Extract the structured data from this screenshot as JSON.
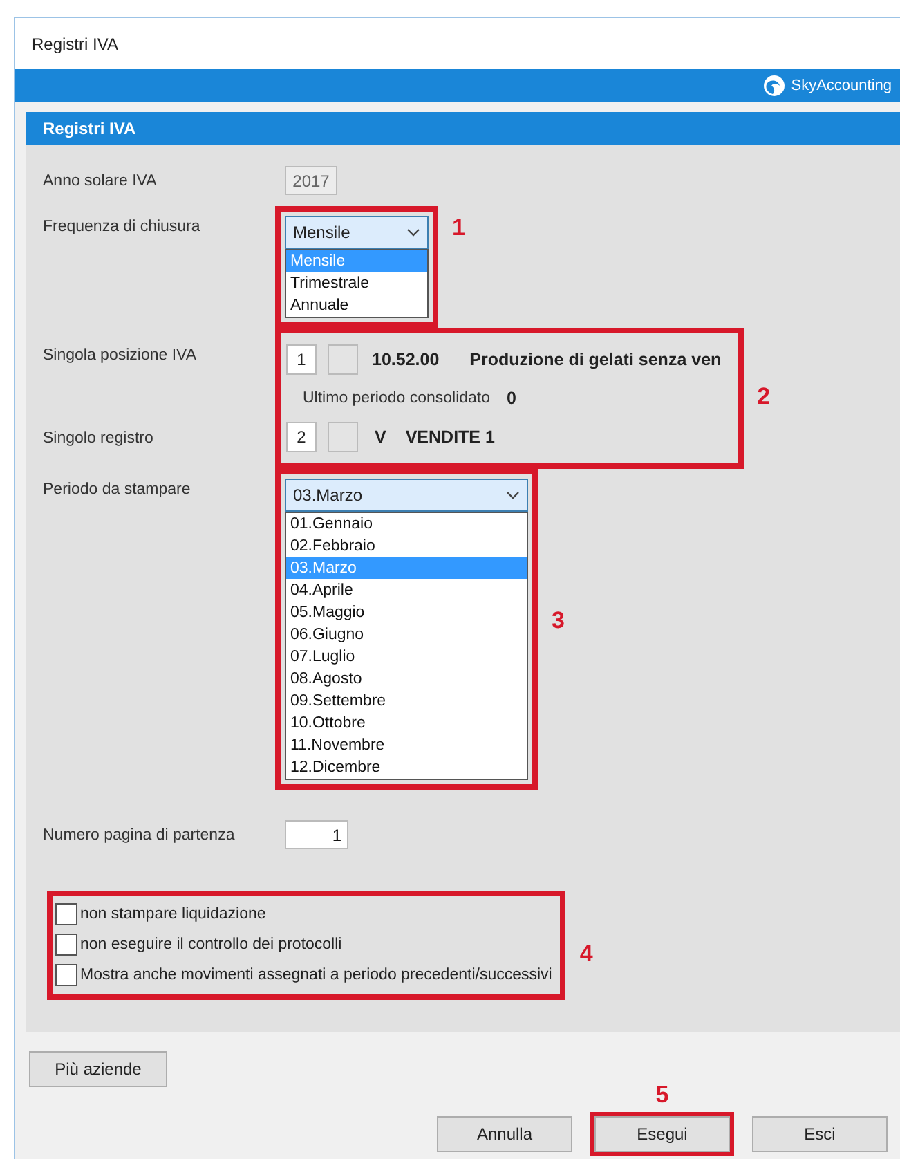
{
  "window": {
    "title": "Registri IVA"
  },
  "brand": {
    "name": "SkyAccounting"
  },
  "panel": {
    "title": "Registri IVA"
  },
  "anno": {
    "label": "Anno solare IVA",
    "value": "2017",
    "disabled": true
  },
  "frequenza": {
    "label": "Frequenza di chiusura",
    "value": "Mensile",
    "annotation": "1",
    "options": [
      {
        "label": "Mensile",
        "selected": true
      },
      {
        "label": "Trimestrale",
        "selected": false
      },
      {
        "label": "Annuale",
        "selected": false
      }
    ]
  },
  "selezione": {
    "annotation": "2",
    "posizione": {
      "label": "Singola posizione IVA",
      "value": "1",
      "code": "10.52.00",
      "description": "Produzione di gelati senza ven"
    },
    "ultimo": {
      "label": "Ultimo periodo consolidato",
      "value": "0"
    },
    "registro": {
      "label": "Singolo registro",
      "value": "2",
      "type": "V",
      "name": "VENDITE 1"
    }
  },
  "periodo": {
    "label": "Periodo da stampare",
    "value": "03.Marzo",
    "annotation": "3",
    "options": [
      {
        "label": "01.Gennaio",
        "selected": false
      },
      {
        "label": "02.Febbraio",
        "selected": false
      },
      {
        "label": "03.Marzo",
        "selected": true
      },
      {
        "label": "04.Aprile",
        "selected": false
      },
      {
        "label": "05.Maggio",
        "selected": false
      },
      {
        "label": "06.Giugno",
        "selected": false
      },
      {
        "label": "07.Luglio",
        "selected": false
      },
      {
        "label": "08.Agosto",
        "selected": false
      },
      {
        "label": "09.Settembre",
        "selected": false
      },
      {
        "label": "10.Ottobre",
        "selected": false
      },
      {
        "label": "11.Novembre",
        "selected": false
      },
      {
        "label": "12.Dicembre",
        "selected": false
      }
    ]
  },
  "numero_pagina": {
    "label": "Numero pagina di partenza",
    "value": "1"
  },
  "opzioni": {
    "annotation": "4",
    "items": [
      {
        "label": "non stampare liquidazione",
        "checked": false
      },
      {
        "label": "non eseguire il controllo dei protocolli",
        "checked": false
      },
      {
        "label": "Mostra anche movimenti assegnati a periodo precedenti/successivi",
        "checked": false
      }
    ]
  },
  "aziende_button": "Più aziende",
  "buttons": [
    {
      "label": "Annulla"
    },
    {
      "label": "Esegui",
      "annotation": "5"
    },
    {
      "label": "Esci"
    }
  ]
}
